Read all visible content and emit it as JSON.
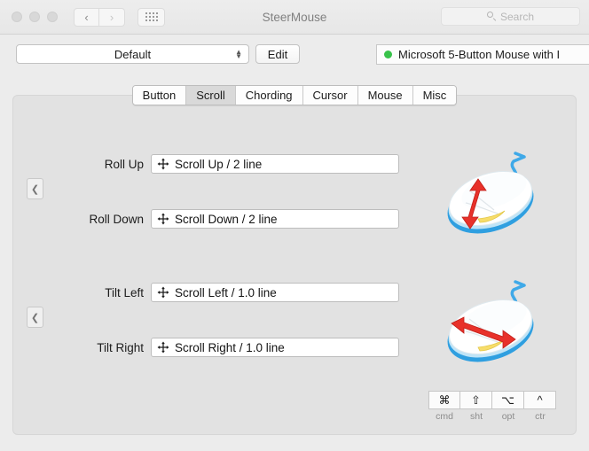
{
  "window": {
    "title": "SteerMouse",
    "traffic_lights": [
      "close",
      "minimize",
      "zoom"
    ],
    "nav_back_icon": "chevron-left-icon",
    "nav_forward_icon": "chevron-right-icon",
    "show_all_icon": "grid-dots-icon"
  },
  "search": {
    "placeholder": "Search",
    "value": "",
    "icon": "search-icon"
  },
  "toolbar": {
    "profile_selected": "Default",
    "profile_options": [
      "Default"
    ],
    "edit_label": "Edit",
    "device_name": "Microsoft 5-Button Mouse with I",
    "device_status_color": "#38c24a"
  },
  "tabs": [
    {
      "label": "Button",
      "selected": false
    },
    {
      "label": "Scroll",
      "selected": true
    },
    {
      "label": "Chording",
      "selected": false
    },
    {
      "label": "Cursor",
      "selected": false
    },
    {
      "label": "Mouse",
      "selected": false
    },
    {
      "label": "Misc",
      "selected": false
    }
  ],
  "groups": [
    {
      "collapse_icon": "chevron-left-icon",
      "illustration": "mouse-vertical-scroll-illustration",
      "rows": [
        {
          "label": "Roll Up",
          "value": "Scroll Up / 2 line",
          "icon": "move-cross-icon"
        },
        {
          "label": "Roll Down",
          "value": "Scroll Down / 2 line",
          "icon": "move-cross-icon"
        }
      ]
    },
    {
      "collapse_icon": "chevron-left-icon",
      "illustration": "mouse-horizontal-tilt-illustration",
      "rows": [
        {
          "label": "Tilt Left",
          "value": "Scroll Left / 1.0 line",
          "icon": "move-cross-icon"
        },
        {
          "label": "Tilt Right",
          "value": "Scroll Right / 1.0 line",
          "icon": "move-cross-icon"
        }
      ]
    }
  ],
  "modifiers": [
    {
      "symbol": "⌘",
      "label": "cmd"
    },
    {
      "symbol": "⇧",
      "label": "sht"
    },
    {
      "symbol": "⌥",
      "label": "opt"
    },
    {
      "symbol": "^",
      "label": "ctr"
    }
  ]
}
